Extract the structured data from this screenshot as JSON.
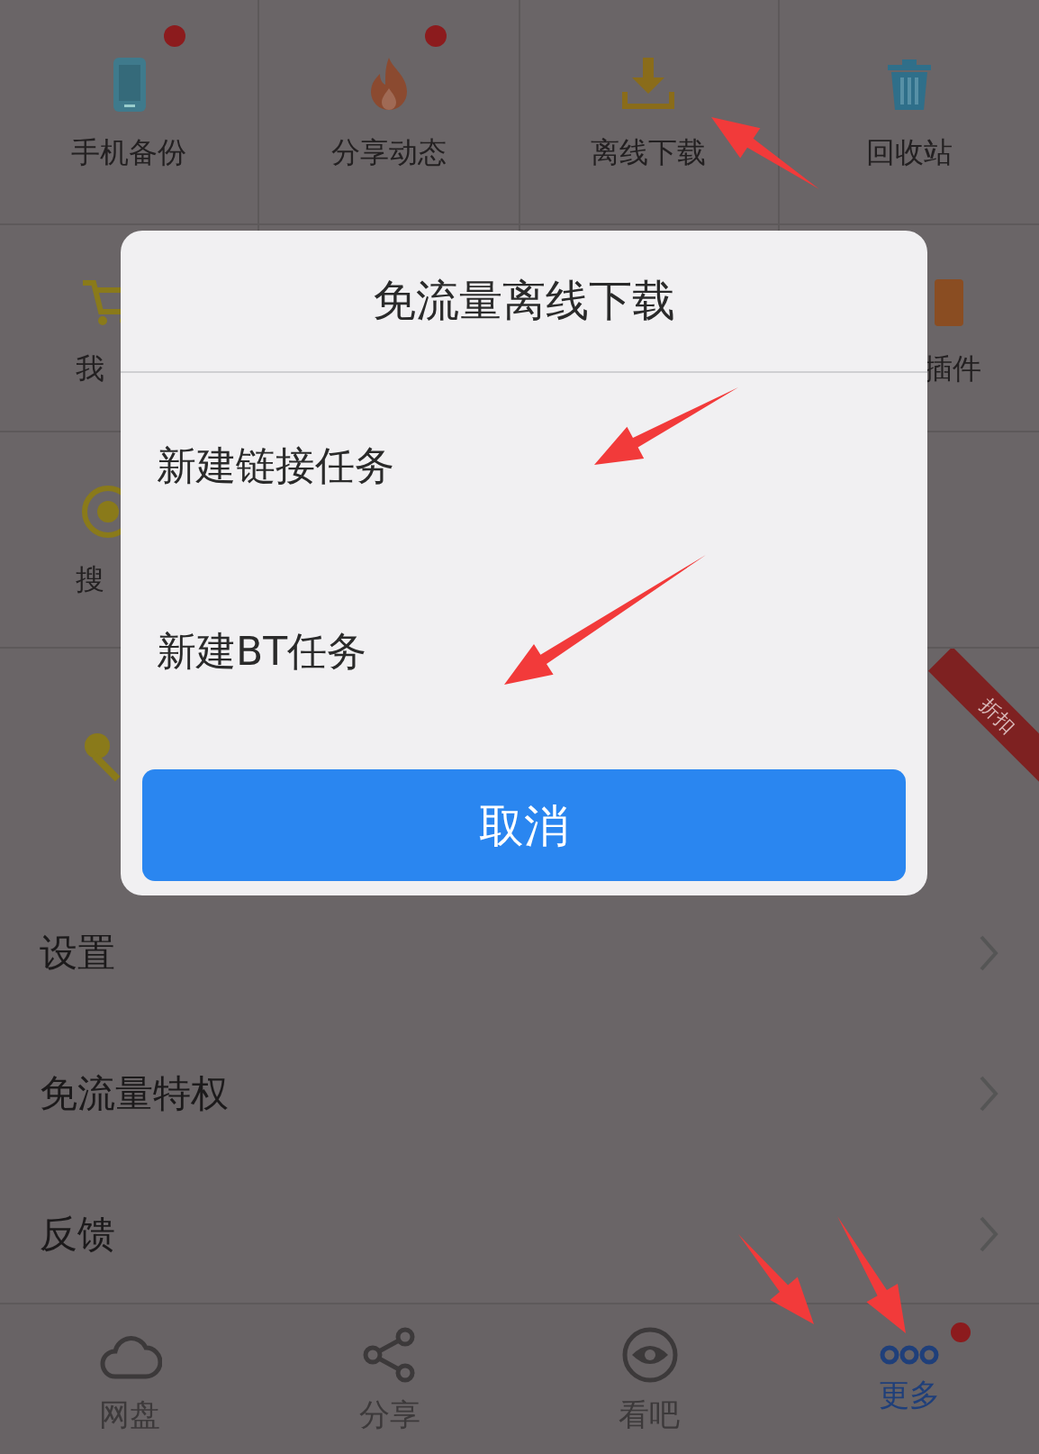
{
  "grid": [
    {
      "label": "手机备份",
      "badge": true
    },
    {
      "label": "分享动态",
      "badge": true
    },
    {
      "label": "离线下载",
      "badge": false
    },
    {
      "label": "回收站",
      "badge": false
    },
    {
      "label": "我"
    },
    {
      "label": "插件",
      "badge": false
    },
    {
      "label": "搜"
    }
  ],
  "promo": {
    "ribbon": "折扣"
  },
  "menu": [
    {
      "label": "设置"
    },
    {
      "label": "免流量特权"
    },
    {
      "label": "反馈"
    }
  ],
  "tabs": [
    {
      "label": "网盘",
      "selected": false,
      "badge": false
    },
    {
      "label": "分享",
      "selected": false,
      "badge": false
    },
    {
      "label": "看吧",
      "selected": false,
      "badge": false
    },
    {
      "label": "更多",
      "selected": true,
      "badge": true
    }
  ],
  "dialog": {
    "title": "免流量离线下载",
    "options": [
      {
        "label": "新建链接任务"
      },
      {
        "label": "新建BT任务"
      }
    ],
    "cancel": "取消"
  }
}
